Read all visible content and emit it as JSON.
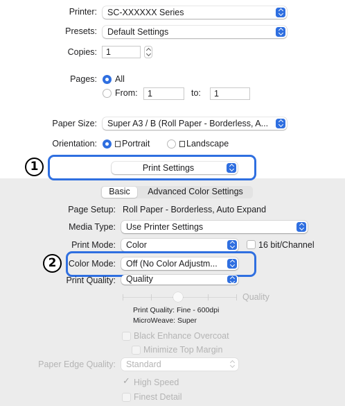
{
  "printer": {
    "label": "Printer:",
    "value": "SC-XXXXXX Series"
  },
  "presets": {
    "label": "Presets:",
    "value": "Default Settings"
  },
  "copies": {
    "label": "Copies:",
    "value": "1"
  },
  "pages": {
    "label": "Pages:",
    "all_label": "All",
    "from_label": "From:",
    "from_value": "1",
    "to_label": "to:",
    "to_value": "1"
  },
  "paper_size": {
    "label": "Paper Size:",
    "value": "Super A3 / B (Roll Paper - Borderless, A..."
  },
  "orientation": {
    "label": "Orientation:",
    "portrait_label": "Portrait",
    "landscape_label": "Landscape"
  },
  "panel_select": {
    "value": "Print Settings"
  },
  "tabs": {
    "basic": "Basic",
    "advanced": "Advanced Color Settings"
  },
  "page_setup": {
    "label": "Page Setup:",
    "value": "Roll Paper - Borderless, Auto Expand"
  },
  "media_type": {
    "label": "Media Type:",
    "value": "Use Printer Settings"
  },
  "print_mode": {
    "label": "Print Mode:",
    "value": "Color",
    "bit_label": "16 bit/Channel"
  },
  "color_mode": {
    "label": "Color Mode:",
    "value": "Off (No Color Adjustm..."
  },
  "print_quality": {
    "label": "Print Quality:",
    "value": "Quality",
    "slider_label": "Quality",
    "info_quality": "Print Quality: Fine - 600dpi",
    "info_microweave": "MicroWeave: Super"
  },
  "options": {
    "black_enhance": "Black Enhance Overcoat",
    "minimize_margin": "Minimize Top Margin",
    "high_speed": "High Speed",
    "finest_detail": "Finest Detail"
  },
  "paper_edge": {
    "label": "Paper Edge Quality:",
    "value": "Standard"
  },
  "callouts": {
    "one": "1",
    "two": "2"
  },
  "colors": {
    "accent": "#2f6fe0",
    "panel_bg": "#ececec"
  }
}
